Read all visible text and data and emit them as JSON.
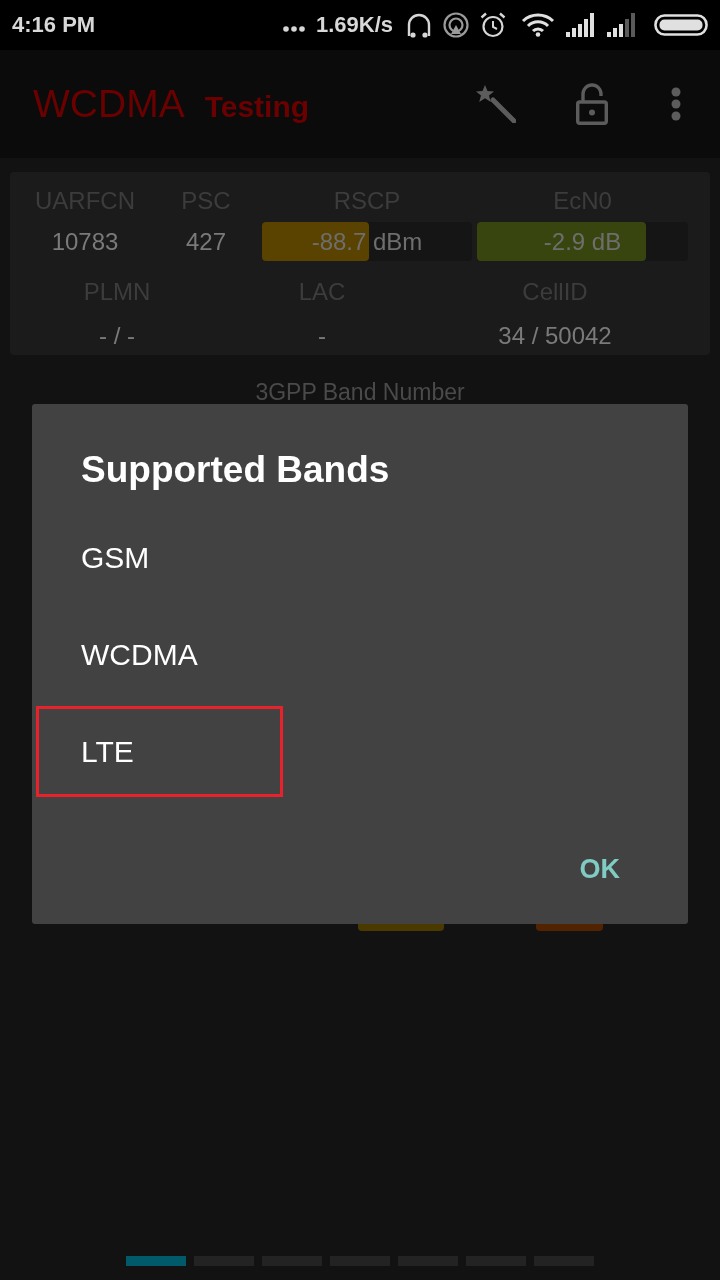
{
  "status_bar": {
    "time": "4:16 PM",
    "speed": "1.69K/s"
  },
  "app_bar": {
    "title": "WCDMA",
    "subtitle": "Testing"
  },
  "cell_info": {
    "row_1": [
      {
        "kind": "text",
        "label": "UARFCN",
        "value": "10783"
      },
      {
        "kind": "text",
        "label": "PSC",
        "value": "427"
      },
      {
        "kind": "meter",
        "label": "RSCP",
        "value": "-88.7 dBm",
        "level": 0.51,
        "color": "#5a4300"
      },
      {
        "kind": "meter",
        "label": "EcN0",
        "value": "-2.9 dB",
        "level": 0.8,
        "color": "#38450f"
      }
    ],
    "row_2": [
      {
        "label": "PLMN",
        "value": "- / -"
      },
      {
        "label": "LAC",
        "value": "-"
      },
      {
        "label": "CellID",
        "value": "34 / 50042"
      }
    ]
  },
  "section_title": "3GPP Band Number",
  "hidden_bars": [
    {
      "color": "#4b3a00"
    },
    {
      "color": "#512300"
    }
  ],
  "dialog": {
    "title": "Supported Bands",
    "items": [
      {
        "label": "GSM",
        "highlighted": false
      },
      {
        "label": "WCDMA",
        "highlighted": false
      },
      {
        "label": "LTE",
        "highlighted": true
      }
    ],
    "button": "OK"
  },
  "pager": [
    {
      "selected": true
    },
    {
      "selected": false
    },
    {
      "selected": false
    },
    {
      "selected": false
    },
    {
      "selected": false
    },
    {
      "selected": false
    },
    {
      "selected": false
    }
  ]
}
